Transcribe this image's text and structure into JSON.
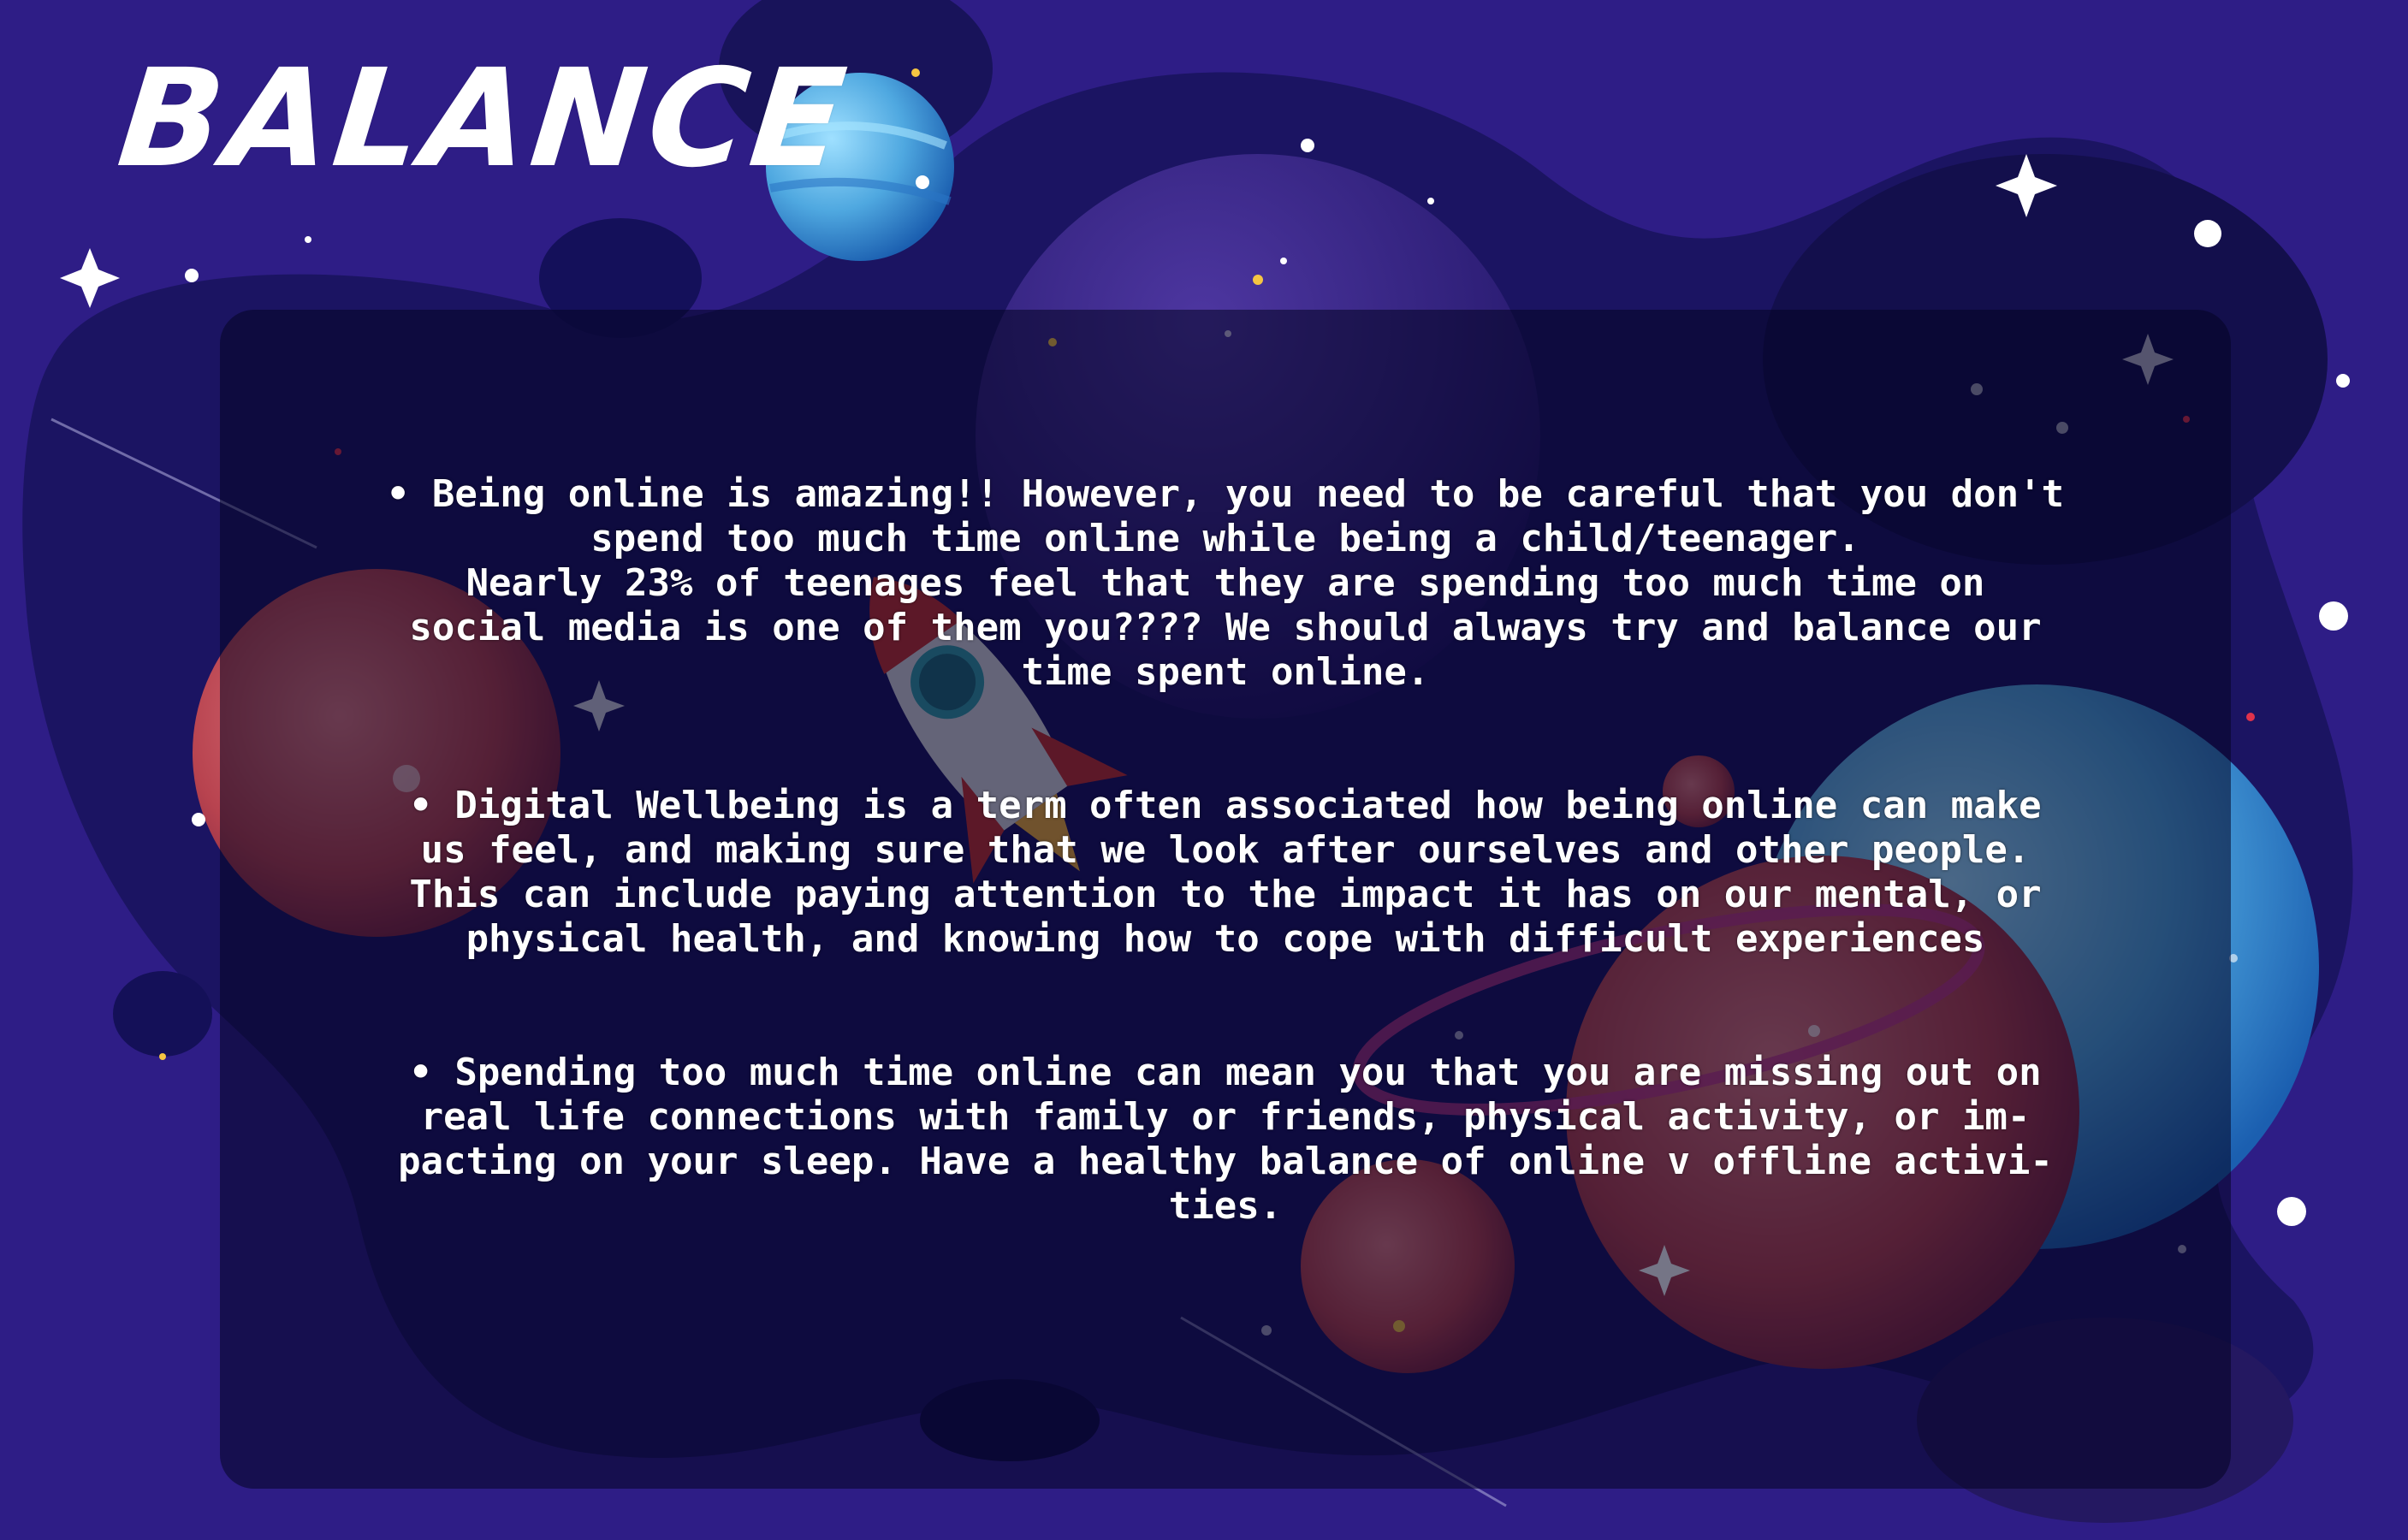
{
  "title": "BALANCE",
  "paragraphs": [
    "• Being online is amazing!! However, you need to be careful that you don't\nspend too much time online while being a child/teenager.\nNearly 23% of teenages feel that they are spending too much time on\nsocial media is one of them you???? We should always try and balance our\ntime spent online.",
    "•  Digital Wellbeing is a term often associated how being online can make\nus feel, and making sure that we look after ourselves and other people.\nThis can include paying attention to the impact it has on our mental, or\nphysical health, and knowing how to cope with difficult experiences",
    " • Spending too much time online can mean you that you are missing out on\nreal life connections with family or friends, physical activity, or im-\npacting on your sleep. Have a healthy balance of online v offline activi-\nties."
  ],
  "colors": {
    "background": "#2e1d86",
    "blob": "#1a1460",
    "panel": "#05052a",
    "text": "#ffffff",
    "planet_red": "#b8434f",
    "planet_blue": "#4fa8e0"
  },
  "illustrations": [
    "rocket-icon",
    "planet",
    "star",
    "sparkle"
  ]
}
